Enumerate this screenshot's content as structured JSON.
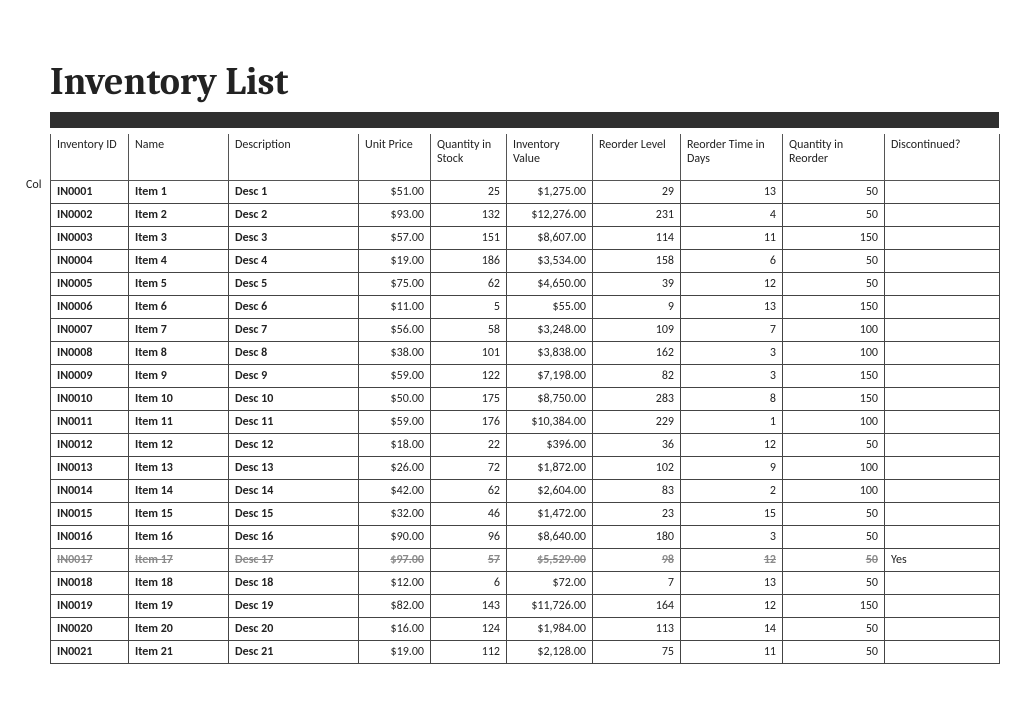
{
  "title": "Inventory List",
  "truncated_side_label": "Col",
  "columns": {
    "id": "Inventory ID",
    "name": "Name",
    "desc": "Description",
    "price": "Unit Price",
    "qty": "Quantity in Stock",
    "val": "Inventory Value",
    "reo": "Reorder Level",
    "days": "Reorder Time in Days",
    "qre": "Quantity in Reorder",
    "disc": "Discontinued?"
  },
  "rows": [
    {
      "id": "IN0001",
      "name": "Item 1",
      "desc": "Desc 1",
      "price": "$51.00",
      "qty": "25",
      "val": "$1,275.00",
      "reo": "29",
      "days": "13",
      "qre": "50",
      "disc": ""
    },
    {
      "id": "IN0002",
      "name": "Item 2",
      "desc": "Desc 2",
      "price": "$93.00",
      "qty": "132",
      "val": "$12,276.00",
      "reo": "231",
      "days": "4",
      "qre": "50",
      "disc": ""
    },
    {
      "id": "IN0003",
      "name": "Item 3",
      "desc": "Desc 3",
      "price": "$57.00",
      "qty": "151",
      "val": "$8,607.00",
      "reo": "114",
      "days": "11",
      "qre": "150",
      "disc": ""
    },
    {
      "id": "IN0004",
      "name": "Item 4",
      "desc": "Desc 4",
      "price": "$19.00",
      "qty": "186",
      "val": "$3,534.00",
      "reo": "158",
      "days": "6",
      "qre": "50",
      "disc": ""
    },
    {
      "id": "IN0005",
      "name": "Item 5",
      "desc": "Desc 5",
      "price": "$75.00",
      "qty": "62",
      "val": "$4,650.00",
      "reo": "39",
      "days": "12",
      "qre": "50",
      "disc": ""
    },
    {
      "id": "IN0006",
      "name": "Item 6",
      "desc": "Desc 6",
      "price": "$11.00",
      "qty": "5",
      "val": "$55.00",
      "reo": "9",
      "days": "13",
      "qre": "150",
      "disc": ""
    },
    {
      "id": "IN0007",
      "name": "Item 7",
      "desc": "Desc 7",
      "price": "$56.00",
      "qty": "58",
      "val": "$3,248.00",
      "reo": "109",
      "days": "7",
      "qre": "100",
      "disc": ""
    },
    {
      "id": "IN0008",
      "name": "Item 8",
      "desc": "Desc 8",
      "price": "$38.00",
      "qty": "101",
      "val": "$3,838.00",
      "reo": "162",
      "days": "3",
      "qre": "100",
      "disc": ""
    },
    {
      "id": "IN0009",
      "name": "Item 9",
      "desc": "Desc 9",
      "price": "$59.00",
      "qty": "122",
      "val": "$7,198.00",
      "reo": "82",
      "days": "3",
      "qre": "150",
      "disc": ""
    },
    {
      "id": "IN0010",
      "name": "Item 10",
      "desc": "Desc 10",
      "price": "$50.00",
      "qty": "175",
      "val": "$8,750.00",
      "reo": "283",
      "days": "8",
      "qre": "150",
      "disc": ""
    },
    {
      "id": "IN0011",
      "name": "Item 11",
      "desc": "Desc 11",
      "price": "$59.00",
      "qty": "176",
      "val": "$10,384.00",
      "reo": "229",
      "days": "1",
      "qre": "100",
      "disc": ""
    },
    {
      "id": "IN0012",
      "name": "Item 12",
      "desc": "Desc 12",
      "price": "$18.00",
      "qty": "22",
      "val": "$396.00",
      "reo": "36",
      "days": "12",
      "qre": "50",
      "disc": ""
    },
    {
      "id": "IN0013",
      "name": "Item 13",
      "desc": "Desc 13",
      "price": "$26.00",
      "qty": "72",
      "val": "$1,872.00",
      "reo": "102",
      "days": "9",
      "qre": "100",
      "disc": ""
    },
    {
      "id": "IN0014",
      "name": "Item 14",
      "desc": "Desc 14",
      "price": "$42.00",
      "qty": "62",
      "val": "$2,604.00",
      "reo": "83",
      "days": "2",
      "qre": "100",
      "disc": ""
    },
    {
      "id": "IN0015",
      "name": "Item 15",
      "desc": "Desc 15",
      "price": "$32.00",
      "qty": "46",
      "val": "$1,472.00",
      "reo": "23",
      "days": "15",
      "qre": "50",
      "disc": ""
    },
    {
      "id": "IN0016",
      "name": "Item 16",
      "desc": "Desc 16",
      "price": "$90.00",
      "qty": "96",
      "val": "$8,640.00",
      "reo": "180",
      "days": "3",
      "qre": "50",
      "disc": ""
    },
    {
      "id": "IN0017",
      "name": "Item 17",
      "desc": "Desc 17",
      "price": "$97.00",
      "qty": "57",
      "val": "$5,529.00",
      "reo": "98",
      "days": "12",
      "qre": "50",
      "disc": "Yes",
      "discontinued": true
    },
    {
      "id": "IN0018",
      "name": "Item 18",
      "desc": "Desc 18",
      "price": "$12.00",
      "qty": "6",
      "val": "$72.00",
      "reo": "7",
      "days": "13",
      "qre": "50",
      "disc": ""
    },
    {
      "id": "IN0019",
      "name": "Item 19",
      "desc": "Desc 19",
      "price": "$82.00",
      "qty": "143",
      "val": "$11,726.00",
      "reo": "164",
      "days": "12",
      "qre": "150",
      "disc": ""
    },
    {
      "id": "IN0020",
      "name": "Item 20",
      "desc": "Desc 20",
      "price": "$16.00",
      "qty": "124",
      "val": "$1,984.00",
      "reo": "113",
      "days": "14",
      "qre": "50",
      "disc": ""
    },
    {
      "id": "IN0021",
      "name": "Item 21",
      "desc": "Desc 21",
      "price": "$19.00",
      "qty": "112",
      "val": "$2,128.00",
      "reo": "75",
      "days": "11",
      "qre": "50",
      "disc": ""
    }
  ]
}
